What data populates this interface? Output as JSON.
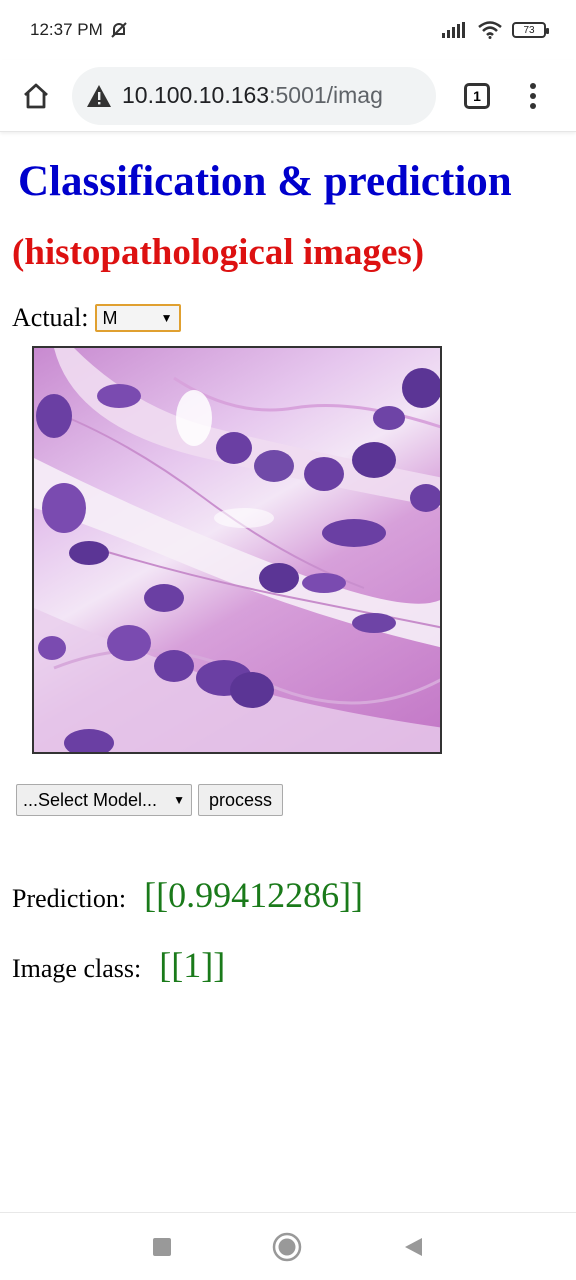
{
  "status": {
    "time": "12:37 PM",
    "battery": "73"
  },
  "browser": {
    "url_host": "10.100.10.163",
    "url_path": ":5001/imag",
    "tab_count": "1"
  },
  "page": {
    "title": "Classification & prediction",
    "subtitle": "(histopathological images)",
    "actual_label": "Actual:",
    "actual_value": "M",
    "model_select": "...Select Model...",
    "process_label": "process",
    "prediction_label": "Prediction:",
    "prediction_value": "[[0.99412286]]",
    "class_label": "Image class:",
    "class_value": "[[1]]"
  },
  "colors": {
    "title": "#0000cc",
    "subtitle": "#dd1111",
    "result": "#1a7a1a"
  }
}
